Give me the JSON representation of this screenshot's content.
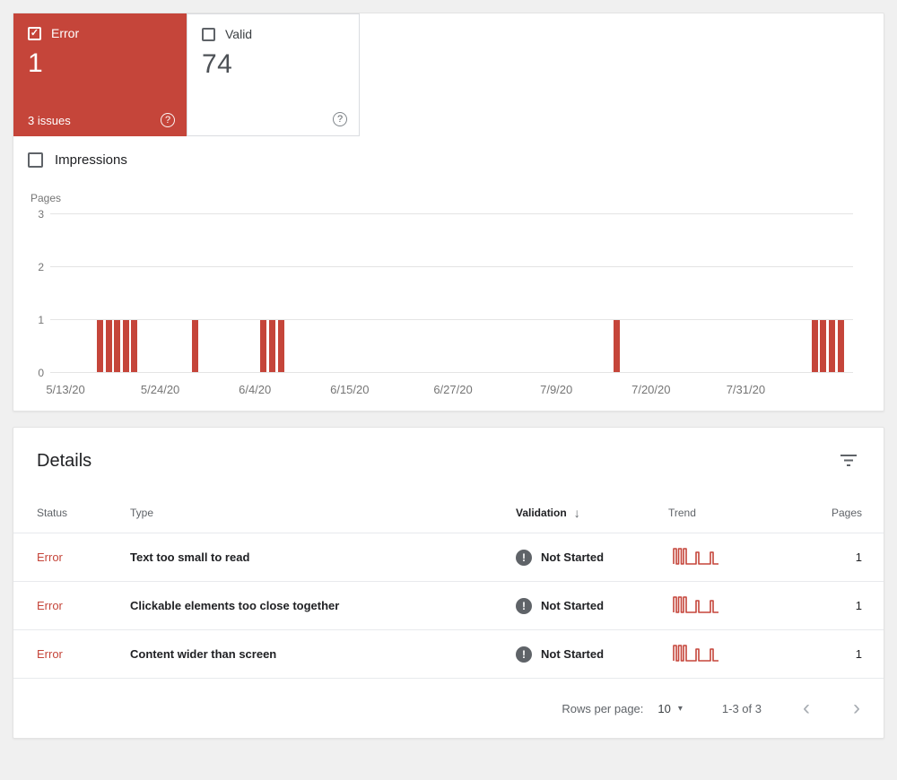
{
  "colors": {
    "accent_red": "#c5453a",
    "text_dark": "#202124",
    "text_gray": "#5f6368",
    "grid_gray": "#e4e4e4"
  },
  "icons": {
    "check": "✓",
    "help": "?",
    "sort_desc": "↓",
    "dropdown": "▾",
    "prev_page": "‹",
    "next_page": "›",
    "exclamation": "!"
  },
  "summary": {
    "error_tab": {
      "label": "Error",
      "value": "1",
      "issues": "3 issues"
    },
    "valid_tab": {
      "label": "Valid",
      "value": "74"
    },
    "impressions_label": "Impressions"
  },
  "chart_data": {
    "type": "bar",
    "title": "",
    "xlabel": "",
    "ylabel": "Pages",
    "ylim": [
      0,
      3
    ],
    "yticks": [
      0,
      1,
      2,
      3
    ],
    "grid": true,
    "bar_color": "#c5453a",
    "start_date": "2020-05-13",
    "end_date": "2020-08-13",
    "xticks": [
      {
        "label": "5/13/20",
        "date": "2020-05-13"
      },
      {
        "label": "5/24/20",
        "date": "2020-05-24"
      },
      {
        "label": "6/4/20",
        "date": "2020-06-04"
      },
      {
        "label": "6/15/20",
        "date": "2020-06-15"
      },
      {
        "label": "6/27/20",
        "date": "2020-06-27"
      },
      {
        "label": "7/9/20",
        "date": "2020-07-09"
      },
      {
        "label": "7/20/20",
        "date": "2020-07-20"
      },
      {
        "label": "7/31/20",
        "date": "2020-07-31"
      }
    ],
    "bars": [
      {
        "date": "2020-05-17",
        "value": 1
      },
      {
        "date": "2020-05-18",
        "value": 1
      },
      {
        "date": "2020-05-19",
        "value": 1
      },
      {
        "date": "2020-05-20",
        "value": 1
      },
      {
        "date": "2020-05-21",
        "value": 1
      },
      {
        "date": "2020-05-28",
        "value": 1
      },
      {
        "date": "2020-06-05",
        "value": 1
      },
      {
        "date": "2020-06-06",
        "value": 1
      },
      {
        "date": "2020-06-07",
        "value": 1
      },
      {
        "date": "2020-07-16",
        "value": 1
      },
      {
        "date": "2020-08-08",
        "value": 1
      },
      {
        "date": "2020-08-09",
        "value": 1
      },
      {
        "date": "2020-08-10",
        "value": 1
      },
      {
        "date": "2020-08-11",
        "value": 1
      }
    ]
  },
  "details": {
    "title": "Details",
    "columns": [
      {
        "label": "Status",
        "sorted": false
      },
      {
        "label": "Type",
        "sorted": false
      },
      {
        "label": "Validation",
        "sorted": true
      },
      {
        "label": "Trend",
        "sorted": false
      },
      {
        "label": "Pages",
        "sorted": false
      }
    ],
    "rows": [
      {
        "status": "Error",
        "type": "Text too small to read",
        "validation": "Not Started",
        "pages": "1"
      },
      {
        "status": "Error",
        "type": "Clickable elements too close together",
        "validation": "Not Started",
        "pages": "1"
      },
      {
        "status": "Error",
        "type": "Content wider than screen",
        "validation": "Not Started",
        "pages": "1"
      }
    ],
    "footer": {
      "rows_per_page_label": "Rows per page:",
      "rows_per_page_value": "10",
      "range": "1-3 of 3"
    }
  }
}
